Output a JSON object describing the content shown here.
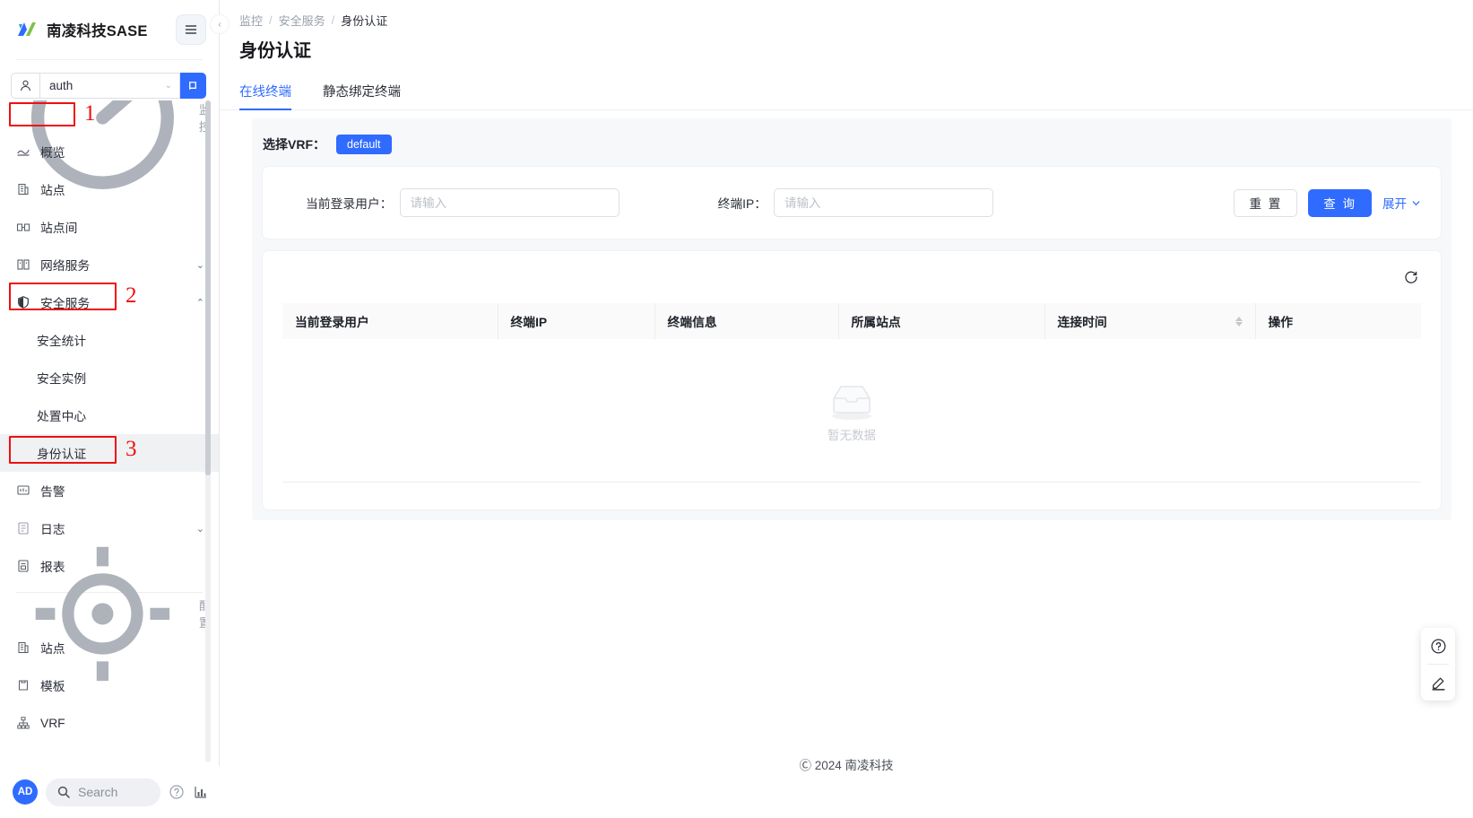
{
  "brand": {
    "title": "南凌科技SASE",
    "logo_icon": "nanling-logo-icon",
    "hamburger_icon": "hamburger-menu-icon"
  },
  "org_selector": {
    "user_icon": "user-icon",
    "value": "auth",
    "caret_icon": "chevron-down-icon",
    "go_icon": "enter-arrow-icon"
  },
  "collapse_handle": {
    "icon": "chevron-left-icon"
  },
  "sidebar": {
    "monitor_group": {
      "label": "监控",
      "icon": "speedometer-icon"
    },
    "monitor_items": [
      {
        "label": "概览",
        "icon": "overview-icon",
        "chevron": ""
      },
      {
        "label": "站点",
        "icon": "building-icon",
        "chevron": ""
      },
      {
        "label": "站点间",
        "icon": "sites-link-icon",
        "chevron": ""
      },
      {
        "label": "网络服务",
        "icon": "network-service-icon",
        "chevron": "⌄"
      },
      {
        "label": "安全服务",
        "icon": "shield-icon",
        "chevron": "⌃"
      }
    ],
    "security_subitems": [
      {
        "label": "安全统计",
        "active": false
      },
      {
        "label": "安全实例",
        "active": false
      },
      {
        "label": "处置中心",
        "active": false
      },
      {
        "label": "身份认证",
        "active": true
      }
    ],
    "monitor_items_after": [
      {
        "label": "告警",
        "icon": "alarm-icon",
        "chevron": ""
      },
      {
        "label": "日志",
        "icon": "log-icon",
        "chevron": "⌄"
      },
      {
        "label": "报表",
        "icon": "report-icon",
        "chevron": ""
      }
    ],
    "config_group": {
      "label": "配置",
      "icon": "config-target-icon"
    },
    "config_items": [
      {
        "label": "站点",
        "icon": "building-icon",
        "chevron": ""
      },
      {
        "label": "模板",
        "icon": "template-icon",
        "chevron": ""
      },
      {
        "label": "VRF",
        "icon": "vrf-tree-icon",
        "chevron": ""
      }
    ]
  },
  "annotations": [
    {
      "number": "1"
    },
    {
      "number": "2"
    },
    {
      "number": "3"
    }
  ],
  "sidebar_footer": {
    "avatar_initials": "AD",
    "search_placeholder": "Search",
    "search_icon": "search-icon",
    "help_icon": "help-circle-icon",
    "stats_icon": "bar-chart-icon"
  },
  "breadcrumb": [
    "监控",
    "安全服务",
    "身份认证"
  ],
  "page": {
    "title": "身份认证"
  },
  "tabs": [
    {
      "label": "在线终端",
      "active": true
    },
    {
      "label": "静态绑定终端",
      "active": false
    }
  ],
  "vrf": {
    "label": "选择VRF：",
    "selected_chip": "default"
  },
  "filters": {
    "user_field": {
      "label": "当前登录用户：",
      "value": "",
      "placeholder": "请输入"
    },
    "ip_field": {
      "label": "终端IP：",
      "value": "",
      "placeholder": "请输入"
    },
    "reset_button": "重 置",
    "query_button": "查 询",
    "expand_link": "展开",
    "expand_icon": "chevron-down-icon"
  },
  "table": {
    "refresh_icon": "refresh-icon",
    "columns": [
      {
        "label": "当前登录用户",
        "sortable": false
      },
      {
        "label": "终端IP",
        "sortable": false
      },
      {
        "label": "终端信息",
        "sortable": false
      },
      {
        "label": "所属站点",
        "sortable": false
      },
      {
        "label": "连接时间",
        "sortable": true
      },
      {
        "label": "操作",
        "sortable": false
      }
    ],
    "rows": [],
    "empty_text": "暂无数据",
    "empty_icon": "empty-box-icon"
  },
  "footer": {
    "copyright": "Ⓒ 2024 南凌科技"
  },
  "fab": {
    "help_icon": "help-circle-icon",
    "edit_icon": "pencil-icon"
  },
  "colors": {
    "accent": "#2f6bff",
    "annotation": "#ee1010",
    "panel_bg": "#f7f8fa",
    "text": "#2b2f38",
    "muted": "#9aa0aa"
  }
}
